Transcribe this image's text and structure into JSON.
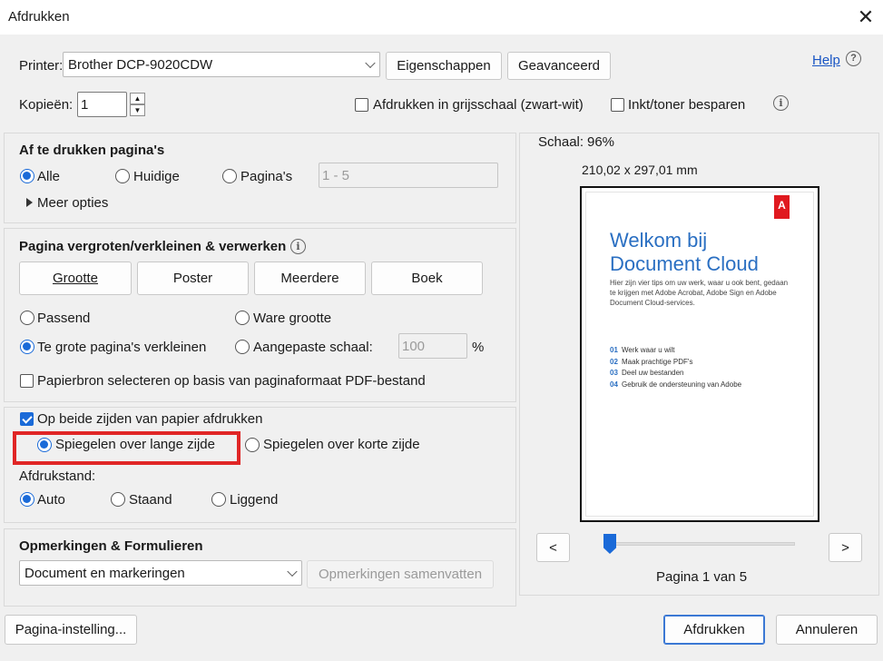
{
  "window": {
    "title": "Afdrukken",
    "close_label": "✕"
  },
  "printer": {
    "label": "Printer:",
    "selected": "Brother DCP-9020CDW",
    "properties_button": "Eigenschappen",
    "advanced_button": "Geavanceerd",
    "help_link": "Help",
    "help_icon": "?"
  },
  "copies": {
    "label": "Kopieën:",
    "value": "1",
    "up": "▲",
    "down": "▼",
    "grayscale_label": "Afdrukken in grijsschaal (zwart-wit)",
    "grayscale_checked": false,
    "save_ink_label": "Inkt/toner besparen",
    "save_ink_checked": false,
    "info_icon": "i"
  },
  "pages_section": {
    "heading": "Af te drukken pagina's",
    "options": [
      {
        "label": "Alle",
        "selected": true
      },
      {
        "label": "Huidige",
        "selected": false
      },
      {
        "label": "Pagina's",
        "selected": false
      }
    ],
    "range_value": "1 - 5",
    "more_options": "Meer opties"
  },
  "scaling_section": {
    "heading": "Pagina vergroten/verkleinen & verwerken",
    "info_icon": "i",
    "tabs": [
      "Grootte",
      "Poster",
      "Meerdere",
      "Boek"
    ],
    "fit": "Passend",
    "actual_size": "Ware grootte",
    "shrink": "Te grote pagina's verkleinen",
    "custom_scale": "Aangepaste schaal:",
    "custom_scale_value": "100",
    "percent": "%",
    "paper_source": "Papierbron selecteren op basis van paginaformaat PDF-bestand"
  },
  "duplex_section": {
    "both_sides": "Op beide zijden van papier afdrukken",
    "flip_long": "Spiegelen over lange zijde",
    "flip_short": "Spiegelen over korte zijde",
    "orientation_label": "Afdrukstand:",
    "orientation": [
      "Auto",
      "Staand",
      "Liggend"
    ]
  },
  "comments_section": {
    "heading": "Opmerkingen & Formulieren",
    "selected": "Document en markeringen",
    "summarize_button": "Opmerkingen samenvatten"
  },
  "preview": {
    "scale_label": "Schaal:",
    "scale_value": "96%",
    "dimensions": "210,02 x 297,01 mm",
    "doc_title": "Welkom bij Document Cloud",
    "doc_intro": "Hier zijn vier tips om uw werk, waar u ook bent, gedaan te krijgen met Adobe Acrobat, Adobe Sign en Adobe Document Cloud-services.",
    "doc_list": [
      {
        "n": "01",
        "text": "Werk waar u wilt"
      },
      {
        "n": "02",
        "text": "Maak prachtige PDF's"
      },
      {
        "n": "03",
        "text": "Deel uw bestanden"
      },
      {
        "n": "04",
        "text": "Gebruik de ondersteuning van Adobe"
      }
    ],
    "logo_text": "A",
    "prev": "<",
    "next": ">",
    "page_position": 0,
    "page_indicator": "Pagina 1 van 5"
  },
  "footer": {
    "page_setup": "Pagina-instelling...",
    "print": "Afdrukken",
    "cancel": "Annuleren"
  },
  "colors": {
    "accent": "#1a6ad8",
    "highlight": "#e02626",
    "doc_title": "#2a6fc2"
  }
}
